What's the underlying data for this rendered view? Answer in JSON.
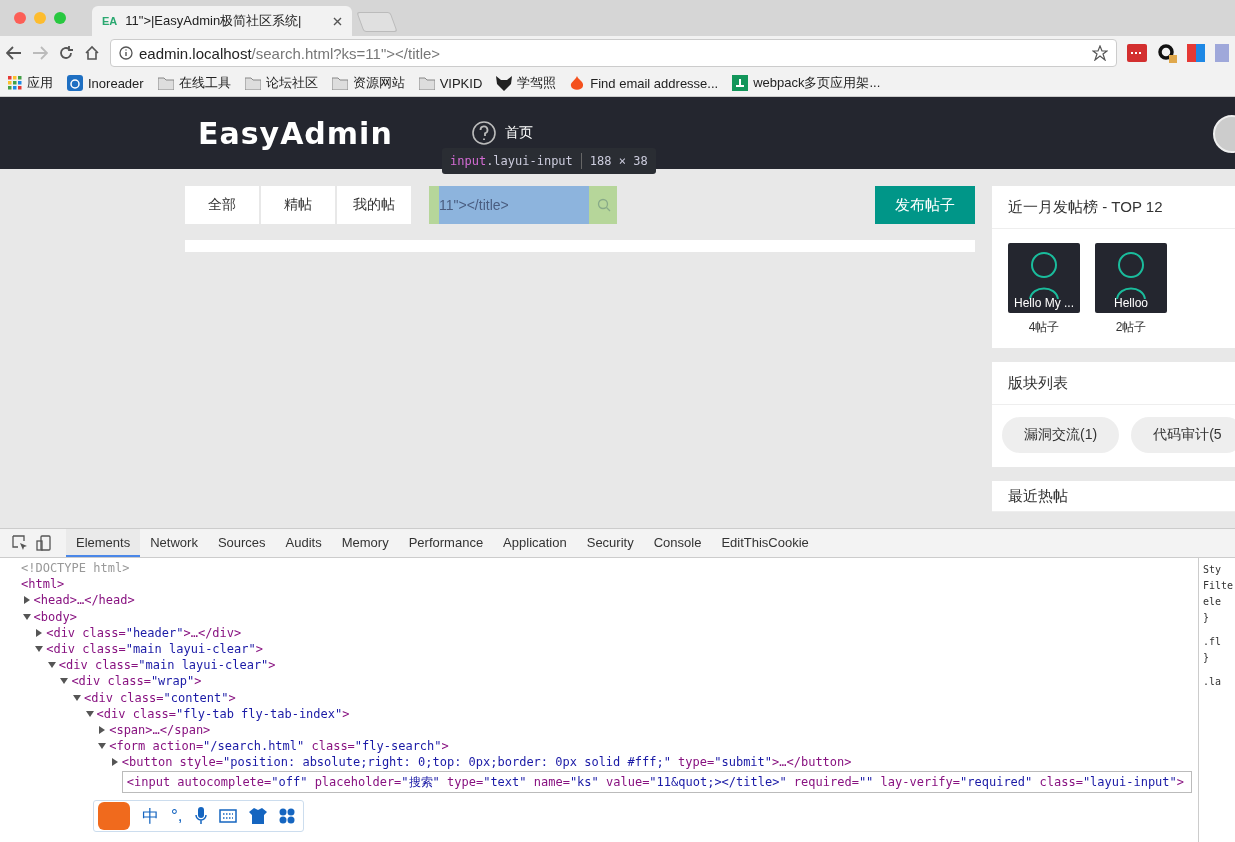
{
  "browser": {
    "tab": {
      "favicon": "EA",
      "title": "11\">|EasyAdmin极简社区系统|"
    },
    "address": {
      "host": "eadmin.localhost",
      "path": "/search.html?ks=11\"></title>"
    },
    "bookmarks": [
      {
        "kind": "apps",
        "label": "应用"
      },
      {
        "kind": "feed",
        "label": "Inoreader"
      },
      {
        "kind": "folder",
        "label": "在线工具"
      },
      {
        "kind": "folder",
        "label": "论坛社区"
      },
      {
        "kind": "folder",
        "label": "资源网站"
      },
      {
        "kind": "folder",
        "label": "VIPKID"
      },
      {
        "kind": "fox",
        "label": "学驾照"
      },
      {
        "kind": "fire",
        "label": "Find email addresse..."
      },
      {
        "kind": "sf",
        "label": "webpack多页应用架..."
      }
    ]
  },
  "site": {
    "logo": "EasyAdmin",
    "nav": "首页",
    "tabs": [
      {
        "label": "全部",
        "selected": false
      },
      {
        "label": "精帖",
        "selected": false
      },
      {
        "label": "我的帖",
        "selected": false
      }
    ],
    "search": {
      "value": "11\"></title>",
      "highlighted": true
    },
    "tooltip": {
      "selector_tag": "input",
      "selector_class": ".layui-input",
      "size": "188 × 38"
    },
    "post_button": "发布帖子",
    "sidebar": {
      "ranking_title": "近一月发帖榜 - TOP 12",
      "users": [
        {
          "name": "Hello My ...",
          "count": "4帖子"
        },
        {
          "name": "Helloo",
          "count": "2帖子"
        }
      ],
      "boards_title": "版块列表",
      "boards": [
        "漏洞交流(1)",
        "代码审计(5"
      ],
      "hot_title": "最近热帖"
    }
  },
  "devtools": {
    "tabs": [
      {
        "label": "Elements",
        "selected": true
      },
      {
        "label": "Network",
        "selected": false
      },
      {
        "label": "Sources",
        "selected": false
      },
      {
        "label": "Audits",
        "selected": false
      },
      {
        "label": "Memory",
        "selected": false
      },
      {
        "label": "Performance",
        "selected": false
      },
      {
        "label": "Application",
        "selected": false
      },
      {
        "label": "Security",
        "selected": false
      },
      {
        "label": "Console",
        "selected": false
      },
      {
        "label": "EditThisCookie",
        "selected": false
      }
    ],
    "tree": [
      {
        "text": "<!DOCTYPE html>",
        "kind": "doctype"
      },
      {
        "text": "<html>",
        "kind": "tag",
        "children": [
          {
            "text": "<head>…</head>",
            "kind": "tag",
            "expanded": false
          },
          {
            "text": "<body>",
            "kind": "tag",
            "expanded": true,
            "children": [
              {
                "text": "<div class=\"header\">…</div>",
                "kind": "tag",
                "expanded": false
              },
              {
                "text": "<div class=\"main layui-clear\">",
                "kind": "tag",
                "expanded": true,
                "children": [
                  {
                    "text": "<div class=\"main layui-clear\">",
                    "kind": "tag",
                    "expanded": true,
                    "children": [
                      {
                        "text": "<div class=\"wrap\">",
                        "kind": "tag",
                        "expanded": true,
                        "children": [
                          {
                            "text": "<div class=\"content\">",
                            "kind": "tag",
                            "expanded": true,
                            "children": [
                              {
                                "text": "<div class=\"fly-tab fly-tab-index\">",
                                "kind": "tag",
                                "expanded": true,
                                "children": [
                                  {
                                    "text": "<span>…</span>",
                                    "kind": "tag",
                                    "expanded": false
                                  },
                                  {
                                    "text": "<form action=\"/search.html\" class=\"fly-search\">",
                                    "kind": "tag",
                                    "expanded": true,
                                    "children": [
                                      {
                                        "text": "<button style=\"position: absolute;right: 0;top: 0px;border: 0px solid #fff;\" type=\"submit\">…</button>",
                                        "kind": "tag",
                                        "expanded": false,
                                        "editing": false
                                      },
                                      {
                                        "text": "<input autocomplete=\"off\" placeholder=\"搜索\" type=\"text\" name=\"ks\" value=\"11&quot;></title>\" required=\"\" lay-verify=\"required\" class=\"layui-input\">",
                                        "kind": "tag",
                                        "editing": true
                                      }
                                    ]
                                  }
                                ]
                              }
                            ]
                          }
                        ]
                      }
                    ]
                  }
                ]
              }
            ]
          }
        ]
      }
    ],
    "styles": [
      "Sty",
      "Filte",
      "ele",
      "}",
      ".fl",
      "}",
      ".la"
    ]
  },
  "ime": {
    "lang": "中",
    "punct": "°,"
  }
}
